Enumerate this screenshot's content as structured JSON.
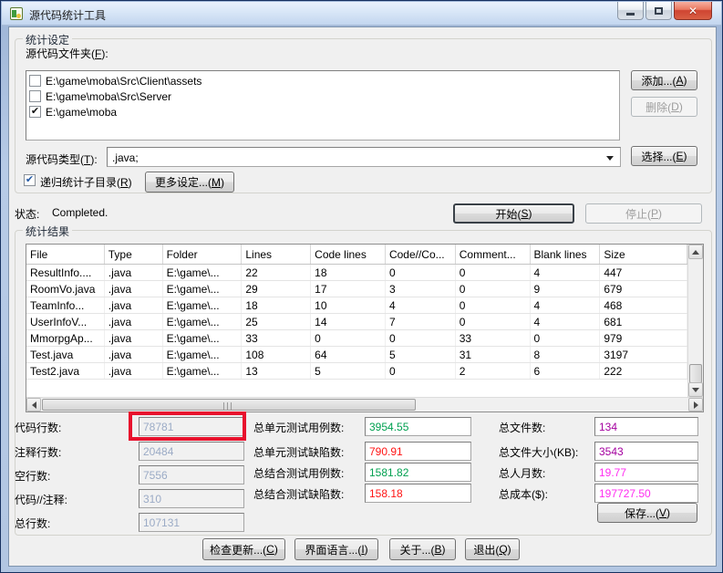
{
  "window": {
    "title": "源代码统计工具"
  },
  "settings": {
    "group_title": "统计设定",
    "folders_label": "源代码文件夹(F):",
    "folders": [
      {
        "path": "E:\\game\\moba\\Src\\Client\\assets",
        "checked": false
      },
      {
        "path": "E:\\game\\moba\\Src\\Server",
        "checked": false
      },
      {
        "path": "E:\\game\\moba",
        "checked": true
      }
    ],
    "add_button": "添加...(A)",
    "delete_button": "删除(D)",
    "type_label": "源代码类型(T):",
    "type_value": ".java;",
    "select_button": "选择...(E)",
    "recurse_checkbox_label": "递归统计子目录(R)",
    "recurse_checked": true,
    "more_settings_button": "更多设定...(M)"
  },
  "status": {
    "label": "状态:",
    "value": "Completed.",
    "start_button": "开始(S)",
    "stop_button": "停止(P)"
  },
  "results": {
    "group_title": "统计结果",
    "table": {
      "columns": [
        "File",
        "Type",
        "Folder",
        "Lines",
        "Code lines",
        "Code//Co...",
        "Comment...",
        "Blank lines",
        "Size"
      ],
      "rows": [
        [
          "ResultInfo....",
          ".java",
          "E:\\game\\...",
          "22",
          "18",
          "0",
          "0",
          "4",
          "447"
        ],
        [
          "RoomVo.java",
          ".java",
          "E:\\game\\...",
          "29",
          "17",
          "3",
          "0",
          "9",
          "679"
        ],
        [
          "TeamInfo...",
          ".java",
          "E:\\game\\...",
          "18",
          "10",
          "4",
          "0",
          "4",
          "468"
        ],
        [
          "UserInfoV...",
          ".java",
          "E:\\game\\...",
          "25",
          "14",
          "7",
          "0",
          "4",
          "681"
        ],
        [
          "MmorpgAp...",
          ".java",
          "E:\\game\\...",
          "33",
          "0",
          "0",
          "33",
          "0",
          "979"
        ],
        [
          "Test.java",
          ".java",
          "E:\\game\\...",
          "108",
          "64",
          "5",
          "31",
          "8",
          "3197"
        ],
        [
          "Test2.java",
          ".java",
          "E:\\game\\...",
          "13",
          "5",
          "0",
          "2",
          "6",
          "222"
        ]
      ]
    },
    "totals_left": [
      {
        "label": "代码行数:",
        "value": "78781",
        "highlight": true
      },
      {
        "label": "注释行数:",
        "value": "20484"
      },
      {
        "label": "空行数:",
        "value": "7556"
      },
      {
        "label": "代码//注释:",
        "value": "310"
      },
      {
        "label": "总行数:",
        "value": "107131"
      }
    ],
    "totals_middle": [
      {
        "label": "总单元测试用例数:",
        "value": "3954.55",
        "color": "#00a050"
      },
      {
        "label": "总单元测试缺陷数:",
        "value": "790.91",
        "color": "#ff1414"
      },
      {
        "label": "总结合测试用例数:",
        "value": "1581.82",
        "color": "#00a050"
      },
      {
        "label": "总结合测试缺陷数:",
        "value": "158.18",
        "color": "#ff1414"
      }
    ],
    "totals_right": [
      {
        "label": "总文件数:",
        "value": "134",
        "color": "#a4009f"
      },
      {
        "label": "总文件大小(KB):",
        "value": "3543",
        "color": "#a4009f"
      },
      {
        "label": "总人月数:",
        "value": "19.77",
        "color": "#ff2ef0"
      },
      {
        "label": "总成本($):",
        "value": "197727.50",
        "color": "#ff2ef0"
      }
    ],
    "save_button": "保存...(V)"
  },
  "footer_buttons": [
    "检查更新...(C)",
    "界面语言...(I)",
    "关于...(B)",
    "退出(Q)"
  ],
  "colors": {
    "disabled_value": "#9babc6",
    "annotation_red": "#e8112d"
  }
}
